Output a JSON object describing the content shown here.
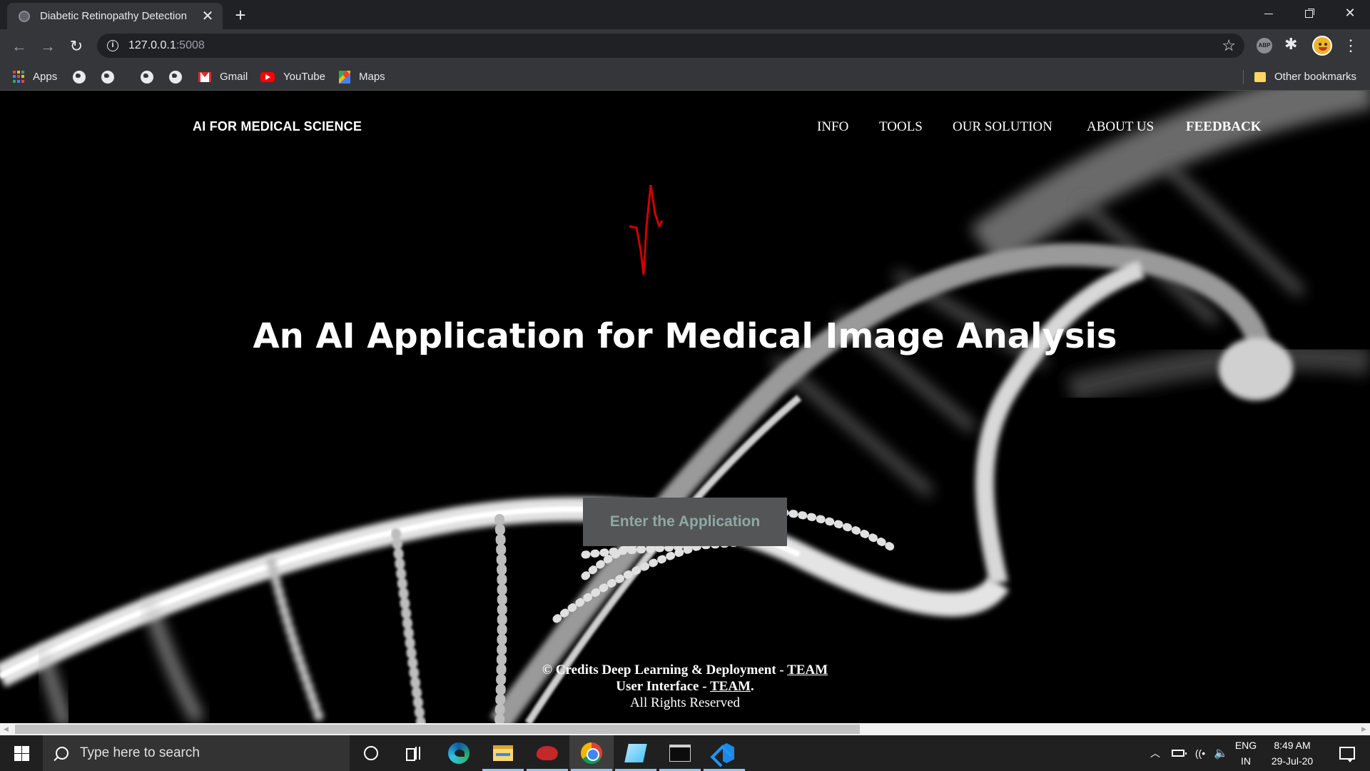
{
  "browser": {
    "tab": {
      "title": "Diabetic Retinopathy Detection"
    },
    "url": {
      "host": "127.0.0.1",
      "port": ":5008"
    },
    "bookmarks": {
      "apps_label": "Apps",
      "items": [
        {
          "label": "Gmail",
          "icon": "gmail-icon"
        },
        {
          "label": "YouTube",
          "icon": "youtube-icon"
        },
        {
          "label": "Maps",
          "icon": "maps-icon"
        }
      ],
      "other_label": "Other bookmarks"
    },
    "extensions": {
      "abp_label": "ABP"
    }
  },
  "site": {
    "brand": "AI FOR MEDICAL SCIENCE",
    "nav": {
      "info": "INFO",
      "tools": "TOOLS",
      "solution": "OUR SOLUTION",
      "about": "ABOUT US",
      "feedback": "FEEDBACK"
    },
    "hero_title": "An AI Application for Medical Image Analysis",
    "enter_button": "Enter the Application",
    "footer": {
      "line1_prefix": "© Credits Deep Learning & Deployment - ",
      "line1_link": "TEAM",
      "line2_prefix": "User Interface - ",
      "line2_link": "TEAM",
      "line2_suffix": ".",
      "line3": "All Rights Reserved"
    },
    "colors": {
      "pulse": "#d10000",
      "button_bg": "#545556",
      "button_text": "#8fa8a6"
    }
  },
  "taskbar": {
    "search_placeholder": "Type here to search",
    "apps": [
      "cortana-icon",
      "task-view-icon",
      "edge-icon",
      "file-explorer-icon",
      "red-app-icon",
      "chrome-icon",
      "notes-app-icon",
      "terminal-icon",
      "vscode-icon"
    ],
    "tray": {
      "lang_line1": "ENG",
      "lang_line2": "IN",
      "time": "8:49 AM",
      "date": "29-Jul-20"
    }
  }
}
